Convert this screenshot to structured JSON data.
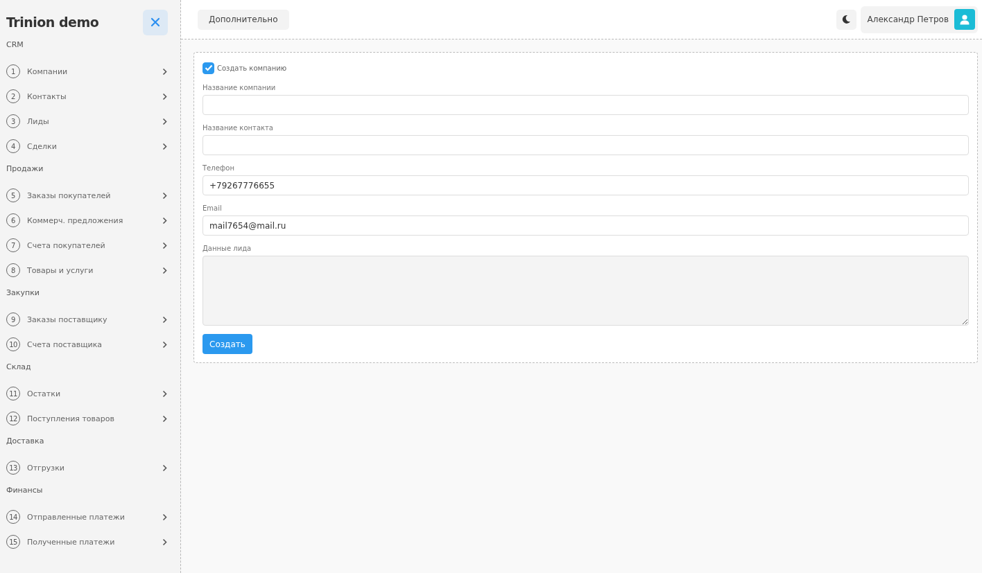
{
  "sidebar": {
    "title": "Trinion demo",
    "sections": [
      {
        "heading": "CRM",
        "items": [
          {
            "number": "1",
            "label": "Компании"
          },
          {
            "number": "2",
            "label": "Контакты"
          },
          {
            "number": "3",
            "label": "Лиды"
          },
          {
            "number": "4",
            "label": "Сделки"
          }
        ]
      },
      {
        "heading": "Продажи",
        "items": [
          {
            "number": "5",
            "label": "Заказы покупателей"
          },
          {
            "number": "6",
            "label": "Коммерч. предложения"
          },
          {
            "number": "7",
            "label": "Счета покупателей"
          },
          {
            "number": "8",
            "label": "Товары и услуги"
          }
        ]
      },
      {
        "heading": "Закупки",
        "items": [
          {
            "number": "9",
            "label": "Заказы поставщику"
          },
          {
            "number": "10",
            "label": "Счета поставщика"
          }
        ]
      },
      {
        "heading": "Склад",
        "items": [
          {
            "number": "11",
            "label": "Остатки"
          },
          {
            "number": "12",
            "label": "Поступления товаров"
          }
        ]
      },
      {
        "heading": "Доставка",
        "items": [
          {
            "number": "13",
            "label": "Отгрузки"
          }
        ]
      },
      {
        "heading": "Финансы",
        "items": [
          {
            "number": "14",
            "label": "Отправленные платежи"
          },
          {
            "number": "15",
            "label": "Полученные платежи"
          }
        ]
      }
    ]
  },
  "header": {
    "menu_button": "Дополнительно",
    "user_name": "Александр Петров"
  },
  "form": {
    "checkbox": {
      "label": "Создать компанию",
      "checked": true
    },
    "fields": [
      {
        "kind": "input",
        "label": "Название компании"
      },
      {
        "kind": "input",
        "label": "Название контакта"
      },
      {
        "kind": "input",
        "label": "Телефон",
        "value": "+79267776655"
      },
      {
        "kind": "input",
        "label": "Email",
        "value": "mail7654@mail.ru"
      },
      {
        "kind": "textarea",
        "label": "Данные лида"
      }
    ],
    "submit": "Создать"
  }
}
